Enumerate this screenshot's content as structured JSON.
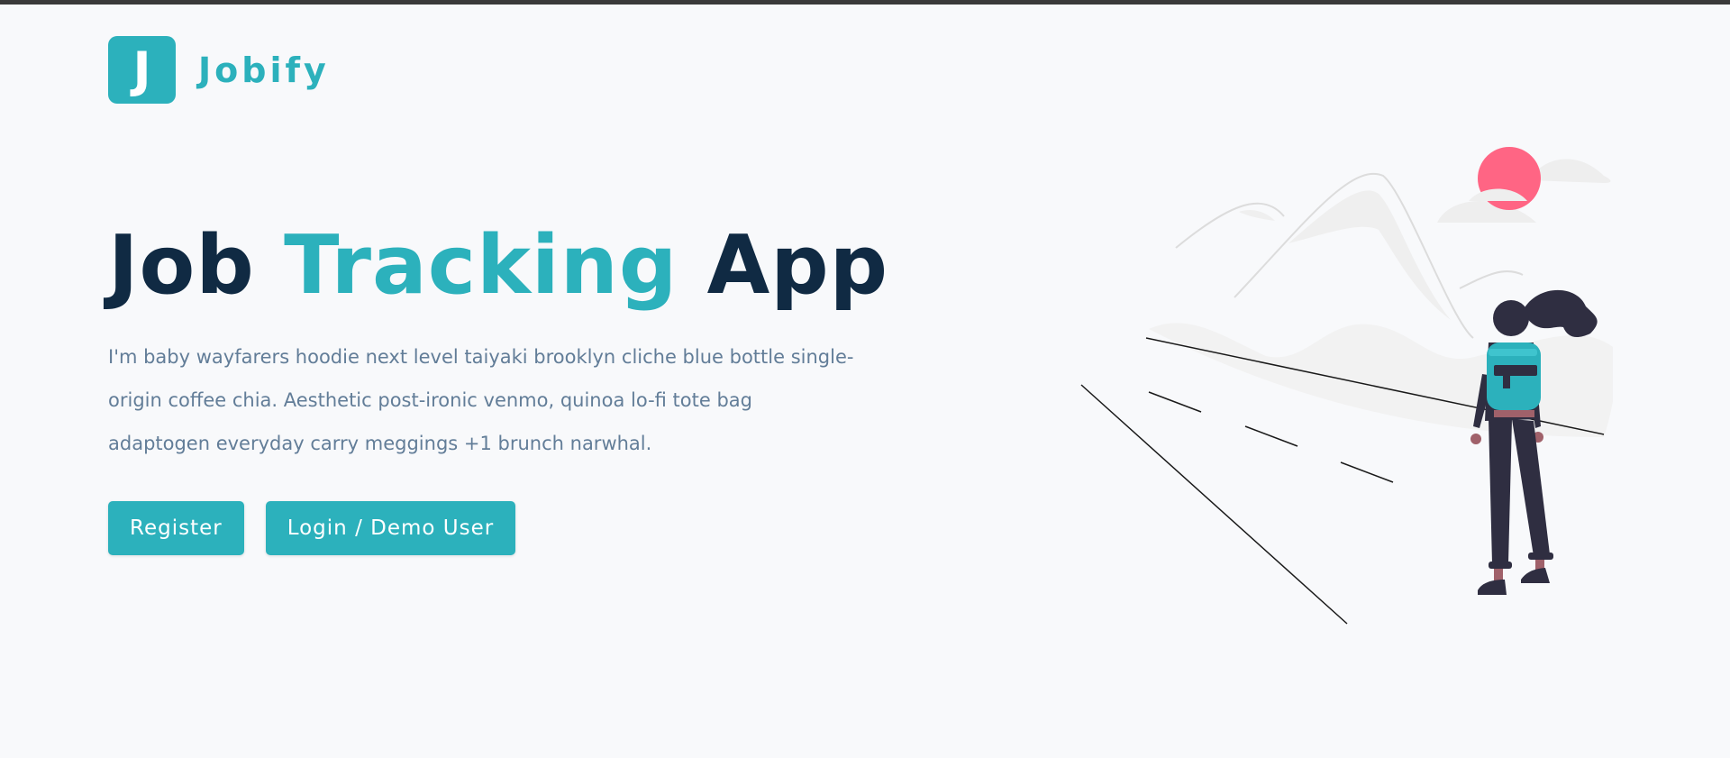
{
  "nav": {
    "logo_letter": "J",
    "brand": "Jobify"
  },
  "hero": {
    "title_part1": "Job",
    "title_accent": "Tracking",
    "title_part2": "App",
    "description": "I'm baby wayfarers hoodie next level taiyaki brooklyn cliche blue bottle single-origin coffee chia. Aesthetic post-ironic venmo, quinoa lo-fi tote bag adaptogen everyday carry meggings +1 brunch narwhal.",
    "register_label": "Register",
    "login_label": "Login / Demo User"
  },
  "colors": {
    "primary": "#2cb1bc",
    "heading": "#102a43",
    "text": "#627d98",
    "background": "#f8f9fb",
    "sun": "#ff6584"
  },
  "illustration": {
    "name": "woman-with-backpack-illustration"
  }
}
